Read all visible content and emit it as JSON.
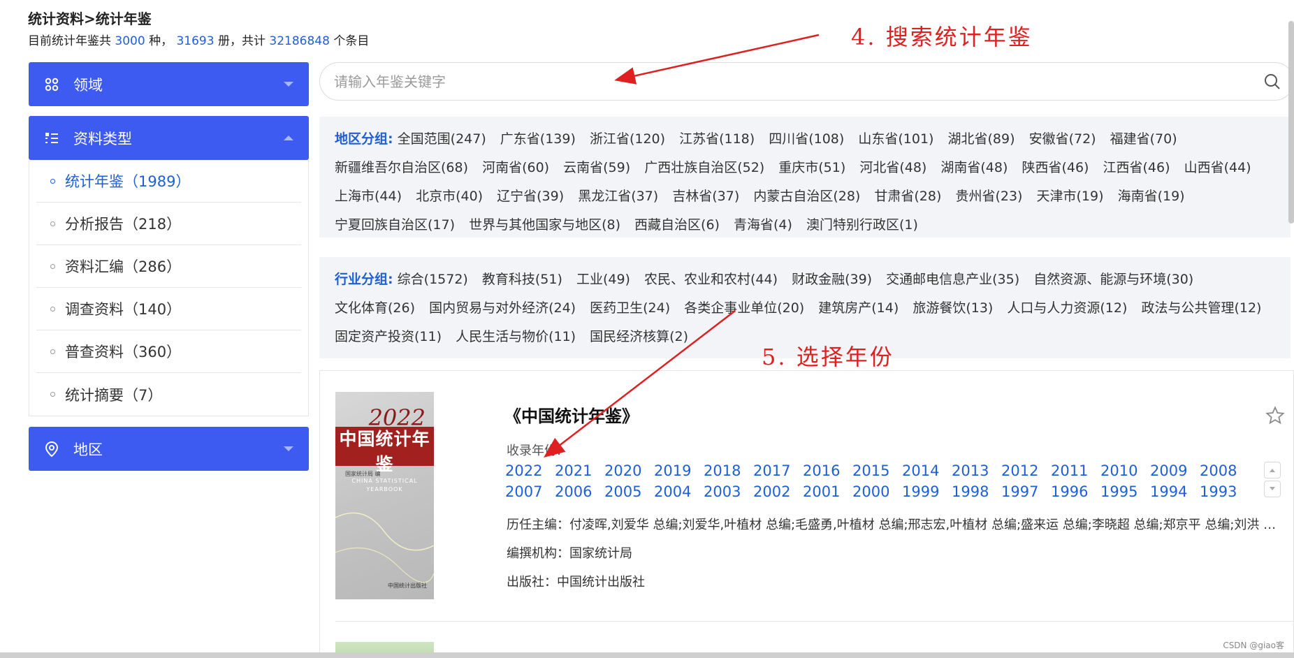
{
  "breadcrumb": "统计资料>统计年鉴",
  "summary": {
    "prefix": "目前统计年鉴共",
    "kinds": "3000",
    "kinds_unit": "种，",
    "volumes": "31693",
    "volumes_unit": "册，共计",
    "entries": "32186848",
    "entries_unit": "个条目"
  },
  "sidebar": {
    "domain_label": "领域",
    "type_label": "资料类型",
    "region_label": "地区",
    "types": [
      {
        "label": "统计年鉴（1989）",
        "active": true
      },
      {
        "label": "分析报告（218）",
        "active": false
      },
      {
        "label": "资料汇编（286）",
        "active": false
      },
      {
        "label": "调查资料（140）",
        "active": false
      },
      {
        "label": "普查资料（360）",
        "active": false
      },
      {
        "label": "统计摘要（7）",
        "active": false
      }
    ]
  },
  "search": {
    "placeholder": "请输入年鉴关键字",
    "icon": "search-icon"
  },
  "region_group": {
    "label": "地区分组:",
    "items": [
      "全国范围(247)",
      "广东省(139)",
      "浙江省(120)",
      "江苏省(118)",
      "四川省(108)",
      "山东省(101)",
      "湖北省(89)",
      "安徽省(72)",
      "福建省(70)",
      "新疆维吾尔自治区(68)",
      "河南省(60)",
      "云南省(59)",
      "广西壮族自治区(52)",
      "重庆市(51)",
      "河北省(48)",
      "湖南省(48)",
      "陕西省(46)",
      "江西省(46)",
      "山西省(44)",
      "上海市(44)",
      "北京市(40)",
      "辽宁省(39)",
      "黑龙江省(37)",
      "吉林省(37)",
      "内蒙古自治区(28)",
      "甘肃省(28)",
      "贵州省(23)",
      "天津市(19)",
      "海南省(19)",
      "宁夏回族自治区(17)",
      "世界与其他国家与地区(8)",
      "西藏自治区(6)",
      "青海省(4)",
      "澳门特别行政区(1)"
    ]
  },
  "industry_group": {
    "label": "行业分组:",
    "items": [
      "综合(1572)",
      "教育科技(51)",
      "工业(49)",
      "农民、农业和农村(44)",
      "财政金融(39)",
      "交通邮电信息产业(35)",
      "自然资源、能源与环境(30)",
      "文化体育(26)",
      "国内贸易与对外经济(24)",
      "医药卫生(24)",
      "各类企事业单位(20)",
      "建筑房产(14)",
      "旅游餐饮(13)",
      "人口与人力资源(12)",
      "政法与公共管理(12)",
      "固定资产投资(11)",
      "人民生活与物价(11)",
      "国民经济核算(2)"
    ]
  },
  "result": {
    "title": "《中国统计年鉴》",
    "years_label": "收录年份:",
    "years": [
      "2022",
      "2021",
      "2020",
      "2019",
      "2018",
      "2017",
      "2016",
      "2015",
      "2014",
      "2013",
      "2012",
      "2011",
      "2010",
      "2009",
      "2008",
      "2007",
      "2006",
      "2005",
      "2004",
      "2003",
      "2002",
      "2001",
      "2000",
      "1999",
      "1998",
      "1997",
      "1996",
      "1995",
      "1994",
      "1993"
    ],
    "editors": "历任主编：付凌晖,刘爱华 总编;刘爱华,叶植材 总编;毛盛勇,叶植材 总编;邢志宏,叶植材 总编;盛来运 总编;李晓超 总编;郑京平 总编;刘洪 主编;...",
    "compiler": "编撰机构：国家统计局",
    "publisher": "出版社：中国统计出版社",
    "cover": {
      "year": "2022",
      "title_cn": "中国统计年鉴",
      "title_en": "CHINA STATISTICAL YEARBOOK",
      "publisher_line": "国家统计局 编",
      "press": "中国统计出版社"
    }
  },
  "annotations": {
    "step4": "4. 搜索统计年鉴",
    "step5": "5. 选择年份",
    "color": "#e02020"
  },
  "colors": {
    "accent": "#3d5af1",
    "link": "#1f5fd6",
    "panel_bg": "#f2f4f7"
  },
  "watermark": "CSDN @giao客"
}
